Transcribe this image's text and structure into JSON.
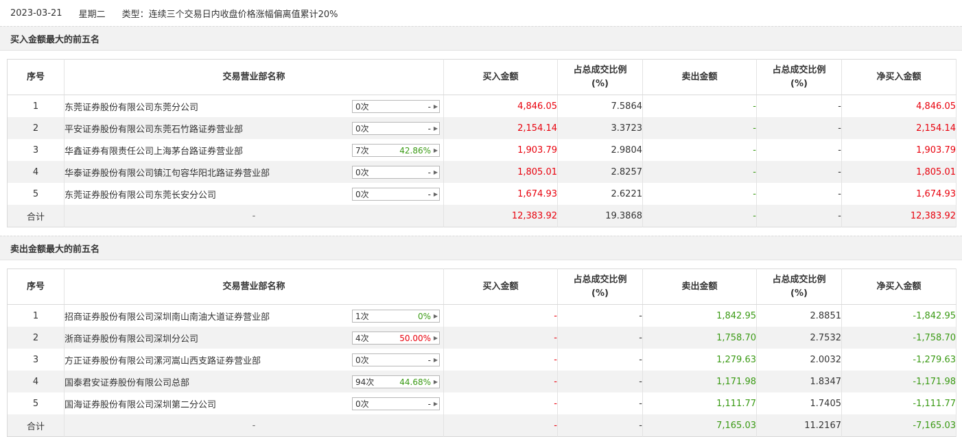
{
  "header": {
    "date": "2023-03-21",
    "weekday": "星期二",
    "type_text": "类型：连续三个交易日内收盘价格涨幅偏离值累计20%"
  },
  "columns": {
    "idx": "序号",
    "name": "交易营业部名称",
    "buy": "买入金额",
    "buy_ratio_l1": "占总成交比例",
    "buy_ratio_l2": "(%)",
    "sell": "卖出金额",
    "sell_ratio_l1": "占总成交比例",
    "sell_ratio_l2": "(%)",
    "net": "净买入金额"
  },
  "buy_section": {
    "title": "买入金额最大的前五名",
    "rows": [
      {
        "idx": "1",
        "name": "东莞证券股份有限公司东莞分公司",
        "count": "0次",
        "pct": "-",
        "buy": "4,846.05",
        "buy_ratio": "7.5864",
        "sell": "-",
        "sell_ratio": "-",
        "net": "4,846.05"
      },
      {
        "idx": "2",
        "name": "平安证券股份有限公司东莞石竹路证券营业部",
        "count": "0次",
        "pct": "-",
        "buy": "2,154.14",
        "buy_ratio": "3.3723",
        "sell": "-",
        "sell_ratio": "-",
        "net": "2,154.14"
      },
      {
        "idx": "3",
        "name": "华鑫证券有限责任公司上海茅台路证券营业部",
        "count": "7次",
        "pct": "42.86%",
        "buy": "1,903.79",
        "buy_ratio": "2.9804",
        "sell": "-",
        "sell_ratio": "-",
        "net": "1,903.79"
      },
      {
        "idx": "4",
        "name": "华泰证券股份有限公司镇江句容华阳北路证券营业部",
        "count": "0次",
        "pct": "-",
        "buy": "1,805.01",
        "buy_ratio": "2.8257",
        "sell": "-",
        "sell_ratio": "-",
        "net": "1,805.01"
      },
      {
        "idx": "5",
        "name": "东莞证券股份有限公司东莞长安分公司",
        "count": "0次",
        "pct": "-",
        "buy": "1,674.93",
        "buy_ratio": "2.6221",
        "sell": "-",
        "sell_ratio": "-",
        "net": "1,674.93"
      }
    ],
    "total": {
      "label": "合计",
      "name": "-",
      "buy": "12,383.92",
      "buy_ratio": "19.3868",
      "sell": "-",
      "sell_ratio": "-",
      "net": "12,383.92"
    }
  },
  "sell_section": {
    "title": "卖出金额最大的前五名",
    "rows": [
      {
        "idx": "1",
        "name": "招商证券股份有限公司深圳南山南油大道证券营业部",
        "count": "1次",
        "pct": "0%",
        "buy": "-",
        "buy_ratio": "-",
        "sell": "1,842.95",
        "sell_ratio": "2.8851",
        "net": "-1,842.95"
      },
      {
        "idx": "2",
        "name": "浙商证券股份有限公司深圳分公司",
        "count": "4次",
        "pct": "50.00%",
        "buy": "-",
        "buy_ratio": "-",
        "sell": "1,758.70",
        "sell_ratio": "2.7532",
        "net": "-1,758.70"
      },
      {
        "idx": "3",
        "name": "方正证券股份有限公司漯河嵩山西支路证券营业部",
        "count": "0次",
        "pct": "-",
        "buy": "-",
        "buy_ratio": "-",
        "sell": "1,279.63",
        "sell_ratio": "2.0032",
        "net": "-1,279.63"
      },
      {
        "idx": "4",
        "name": "国泰君安证券股份有限公司总部",
        "count": "94次",
        "pct": "44.68%",
        "buy": "-",
        "buy_ratio": "-",
        "sell": "1,171.98",
        "sell_ratio": "1.8347",
        "net": "-1,171.98"
      },
      {
        "idx": "5",
        "name": "国海证券股份有限公司深圳第二分公司",
        "count": "0次",
        "pct": "-",
        "buy": "-",
        "buy_ratio": "-",
        "sell": "1,111.77",
        "sell_ratio": "1.7405",
        "net": "-1,111.77"
      }
    ],
    "total": {
      "label": "合计",
      "name": "-",
      "buy": "-",
      "buy_ratio": "-",
      "sell": "7,165.03",
      "sell_ratio": "11.2167",
      "net": "-7,165.03"
    }
  },
  "colors": {
    "up": "#e8000c",
    "down": "#3a9a14"
  },
  "icons": {
    "stat_arrow": "caret-right-icon"
  }
}
